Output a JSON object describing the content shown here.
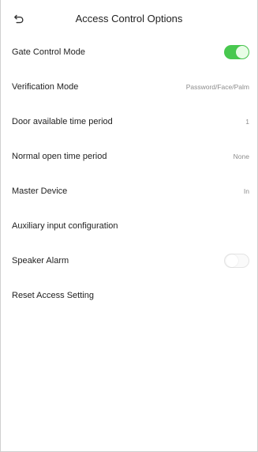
{
  "header": {
    "back_icon": "back-arrow-icon",
    "title": "Access Control Options"
  },
  "colors": {
    "toggle_on": "#48c84f",
    "toggle_off": "#fafafa",
    "value_text": "#8d8d8d"
  },
  "settings": [
    {
      "label": "Gate Control Mode",
      "control": "toggle",
      "toggle_state": "on"
    },
    {
      "label": "Verification Mode",
      "value": "Password/Face/Palm"
    },
    {
      "label": "Door available time period",
      "value": "1"
    },
    {
      "label": "Normal open time period",
      "value": "None"
    },
    {
      "label": "Master Device",
      "value": "In"
    },
    {
      "label": "Auxiliary input configuration"
    },
    {
      "label": "Speaker Alarm",
      "control": "toggle",
      "toggle_state": "off"
    },
    {
      "label": "Reset Access Setting"
    }
  ]
}
